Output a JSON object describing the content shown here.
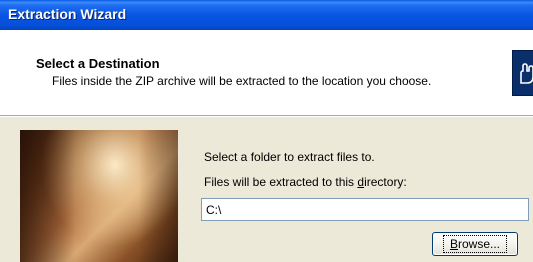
{
  "window": {
    "title": "Extraction Wizard"
  },
  "header": {
    "title": "Select a Destination",
    "description": "Files inside the ZIP archive will be extracted to the location you choose.",
    "icon": "wizard-hand-icon"
  },
  "body": {
    "select_folder_label": "Select a folder to extract files to.",
    "directory_label_pre": "Files will be extracted to this ",
    "directory_label_accel": "d",
    "directory_label_post": "irectory:",
    "path_value": "C:\\",
    "browse_label_accel": "B",
    "browse_label_rest": "rowse..."
  },
  "colors": {
    "titlebar": "#0854E3",
    "face": "#ECE9D8",
    "input_border": "#7F9DB9"
  }
}
